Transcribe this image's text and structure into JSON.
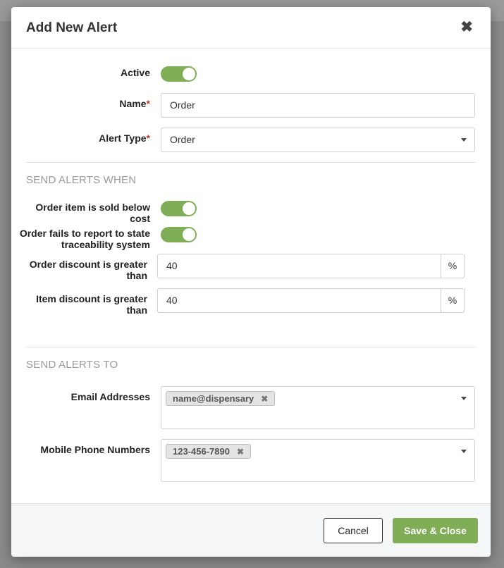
{
  "modal": {
    "title": "Add New Alert",
    "close_icon": "close-icon",
    "close_glyph": "✖"
  },
  "general": {
    "active_label": "Active",
    "active_on": true,
    "name_label": "Name",
    "name_value": "Order",
    "alert_type_label": "Alert Type",
    "alert_type_value": "Order",
    "required_mark": "*"
  },
  "send_when": {
    "section_title": "SEND ALERTS WHEN",
    "sold_below_cost_label_line1": "Order item is sold below",
    "sold_below_cost_label_line2": "cost",
    "sold_below_cost_on": true,
    "fails_report_label_line1": "Order fails to report to state",
    "fails_report_label_line2": "traceability system",
    "fails_report_on": true,
    "order_discount_label_line1": "Order discount is greater",
    "order_discount_label_line2": "than",
    "order_discount_value": "40",
    "item_discount_label_line1": "Item discount is greater",
    "item_discount_label_line2": "than",
    "item_discount_value": "40",
    "percent_symbol": "%"
  },
  "send_to": {
    "section_title": "SEND ALERTS TO",
    "email_label": "Email Addresses",
    "email_tags": [
      "name@dispensary"
    ],
    "phone_label": "Mobile Phone Numbers",
    "phone_tags": [
      "123-456-7890"
    ],
    "tag_remove_glyph": "✖"
  },
  "footer": {
    "cancel_label": "Cancel",
    "save_label": "Save & Close"
  },
  "colors": {
    "accent_green": "#7fae57",
    "required_red": "#c0392b",
    "section_gray": "#999999"
  }
}
